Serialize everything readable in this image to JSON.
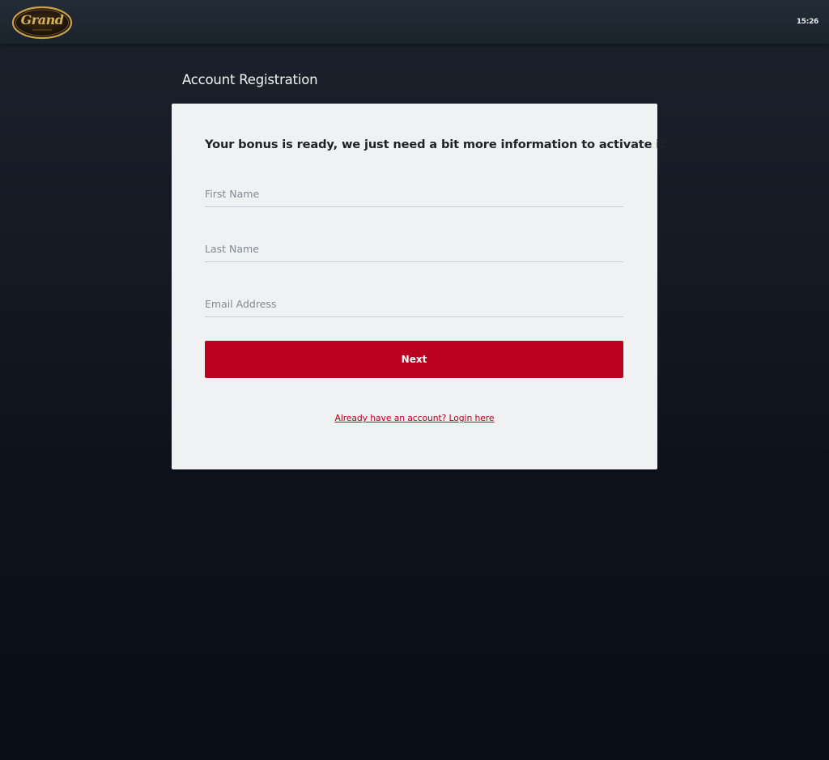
{
  "header": {
    "logo_text": "Grand",
    "clock": "15:26"
  },
  "page": {
    "title": "Account Registration"
  },
  "form": {
    "heading": "Your bonus is ready, we just need a bit more information to activate it",
    "fields": [
      {
        "placeholder": "First Name",
        "value": ""
      },
      {
        "placeholder": "Last Name",
        "value": ""
      },
      {
        "placeholder": "Email Address",
        "value": ""
      }
    ],
    "next_label": "Next",
    "login_link": "Already have an account? Login here"
  },
  "colors": {
    "accent": "#ba0020",
    "card_bg": "#f0f1f2",
    "page_bg": "#0c121b",
    "logo_gold": "#c9a24a"
  }
}
